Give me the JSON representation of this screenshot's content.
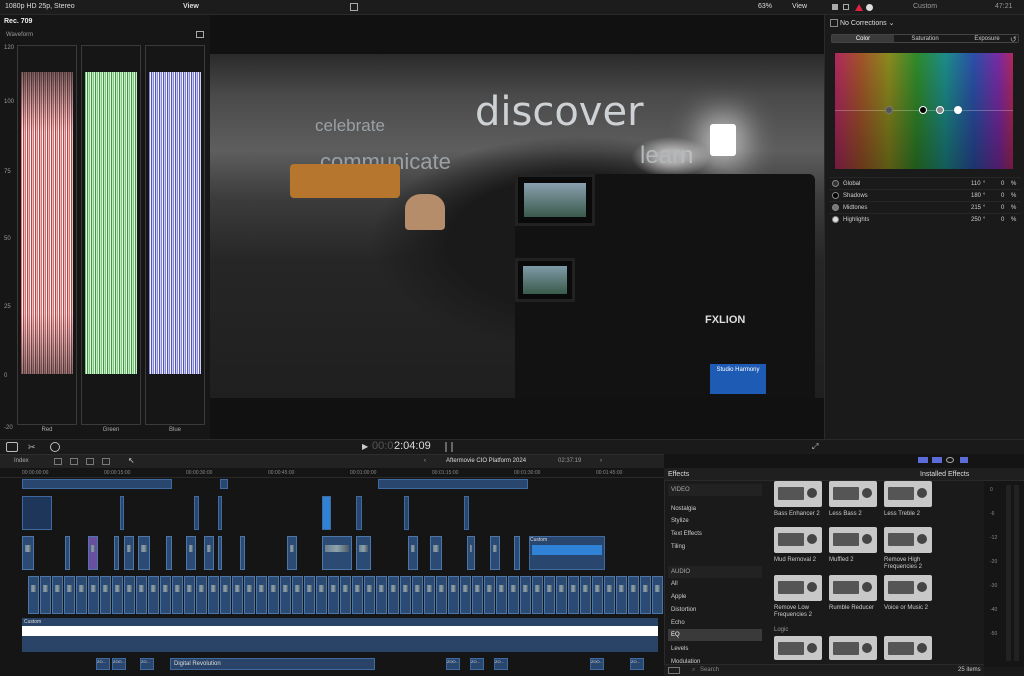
{
  "top_bar": {
    "format": "1080p HD 25p, Stereo",
    "zoom": "63%",
    "view_menu_viewer": "View",
    "view_menu_scopes": "View",
    "inspector_title": "Custom",
    "timecode_right": "47:21"
  },
  "scopes": {
    "standard": "Rec. 709",
    "mode": "Waveform",
    "y_ticks": [
      "120",
      "100",
      "75",
      "50",
      "25",
      "0",
      "-20"
    ],
    "channels": [
      "Red",
      "Green",
      "Blue"
    ]
  },
  "viewer": {
    "timecode": "2:04:09",
    "timecode_prefix": "00:0",
    "wall_text": [
      "celebrate",
      "discover",
      "communicate",
      "learn"
    ],
    "camera_brand": "FXLION",
    "badge": "Studio Harmony"
  },
  "inspector": {
    "preset": "No Corrections",
    "tabs": [
      "Color",
      "Saturation",
      "Exposure"
    ],
    "rows": [
      {
        "label": "Global",
        "angle": "110",
        "deg": "°",
        "value": "0",
        "unit": "%"
      },
      {
        "label": "Shadows",
        "angle": "180",
        "deg": "°",
        "value": "0",
        "unit": "%"
      },
      {
        "label": "Midtones",
        "angle": "215",
        "deg": "°",
        "value": "0",
        "unit": "%"
      },
      {
        "label": "Highlights",
        "angle": "250",
        "deg": "°",
        "value": "0",
        "unit": "%"
      }
    ]
  },
  "timeline": {
    "index_label": "Index",
    "project": "Aftermovie CIO Platform 2024",
    "duration": "02:37:19",
    "ruler": [
      "00:00:00:00",
      "00:00:15:00",
      "00:00:30:00",
      "00:00:45:00",
      "00:01:00:00",
      "00:01:15:00",
      "00:01:30:00",
      "00:01:45:00"
    ],
    "custom_label": "Custom",
    "custom_label_upper": "Custom",
    "bottom_clip": "Digital Revolution",
    "clip_codes": [
      "ZO...",
      "ZOO...",
      "ZO...",
      "ZOO...",
      "ZO..."
    ]
  },
  "effects": {
    "title": "Effects",
    "filter": "Installed Effects",
    "categories": [
      "VIDEO",
      "Nostalgia",
      "Stylize",
      "Text Effects",
      "Tiling",
      "AUDIO",
      "All",
      "Apple",
      "Distortion",
      "Echo",
      "EQ",
      "Levels",
      "Modulation"
    ],
    "selected_category": "EQ",
    "tiles": [
      "Bass Enhancer 2",
      "Less Bass 2",
      "Less Treble 2",
      "Mud Removal 2",
      "Muffled 2",
      "Remove High Frequencies 2",
      "Remove Low Frequencies 2",
      "Rumble Reducer",
      "Voice or Music 2"
    ],
    "section": "Logic",
    "search_placeholder": "Search",
    "count": "25 items"
  },
  "meters": {
    "ticks": [
      "0",
      "-6",
      "-12",
      "-20",
      "-30",
      "-40",
      "-50"
    ]
  },
  "colors": {
    "accent": "#3c82d8",
    "clip": "#29466e",
    "custom_clip": "#2f82d6",
    "purple_clip": "#6a4fa0"
  }
}
